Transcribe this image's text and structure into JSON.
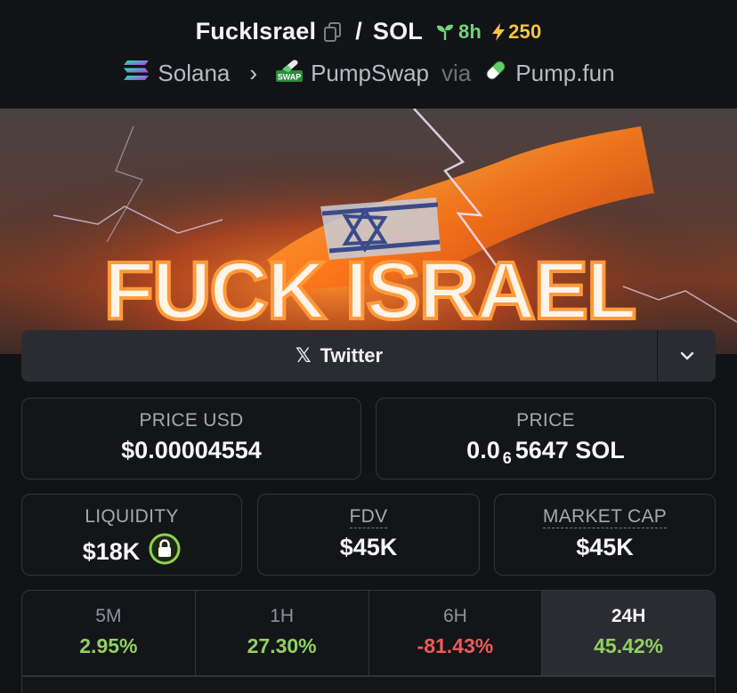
{
  "header": {
    "token_name": "FuckIsrael",
    "quote": "SOL",
    "age": "8h",
    "boosts": "250",
    "chain": "Solana",
    "dex": "PumpSwap",
    "dex_badge": "SWAP",
    "via_label": "via",
    "launchpad": "Pump.fun"
  },
  "banner": {
    "text": "FUCK ISRAEL"
  },
  "social": {
    "twitter_label": "Twitter",
    "x_glyph": "𝕏"
  },
  "stats": {
    "price_usd_label": "PRICE USD",
    "price_usd_value": "$0.00004554",
    "price_label": "PRICE",
    "price_prefix": "0.0",
    "price_zero_count": "6",
    "price_suffix": "5647 SOL",
    "liquidity_label": "LIQUIDITY",
    "liquidity_value": "$18K",
    "fdv_label": "FDV",
    "fdv_value": "$45K",
    "mcap_label": "MARKET CAP",
    "mcap_value": "$45K"
  },
  "timeframes": [
    {
      "label": "5M",
      "value": "2.95%",
      "trend": "pos"
    },
    {
      "label": "1H",
      "value": "27.30%",
      "trend": "pos"
    },
    {
      "label": "6H",
      "value": "-81.43%",
      "trend": "neg"
    },
    {
      "label": "24H",
      "value": "45.42%",
      "trend": "pos",
      "active": true
    }
  ],
  "colors": {
    "background": "#121316",
    "card_border": "#34353b",
    "positive": "#90d060",
    "negative": "#ee5a5a",
    "age_green": "#6fd47a",
    "boost_yellow": "#f5c542"
  },
  "icons": [
    "copy-icon",
    "seedling-icon",
    "lightning-icon",
    "solana-icon",
    "pumpswap-icon",
    "pill-icon",
    "chevron-down-icon",
    "lock-icon"
  ]
}
